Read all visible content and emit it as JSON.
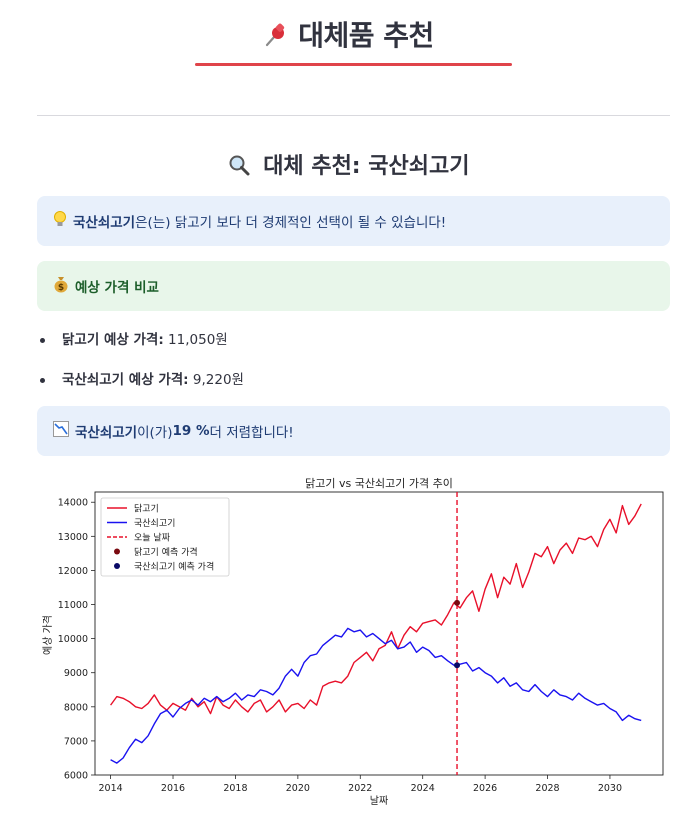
{
  "header": {
    "title_icon": "pushpin-icon",
    "title": "대체품 추천"
  },
  "section": {
    "icon": "magnifier-icon",
    "title": "대체 추천: 국산쇠고기"
  },
  "recommendation": {
    "icon": "lightbulb-icon",
    "item": "국산쇠고기",
    "text": " 은(는) 닭고기 보다 더 경제적인 선택이 될 수 있습니다!"
  },
  "comparison": {
    "icon": "money-bag-icon",
    "title": "예상 가격 비교"
  },
  "prices": [
    {
      "label": "닭고기 예상 가격:",
      "value": " 11,050원"
    },
    {
      "label": "국산쇠고기 예상 가격:",
      "value": " 9,220원"
    }
  ],
  "savings": {
    "icon": "chart-decreasing-icon",
    "item": "국산쇠고기",
    "text1": " 이(가) ",
    "percent": "19 %",
    "text2": " 더 저렴합니다!"
  },
  "colors": {
    "chicken": "#e8102a",
    "beef": "#1a12f0",
    "today": "#e8102a",
    "chicken_pred": "#7a0a10",
    "beef_pred": "#0a0a66"
  },
  "chart_data": {
    "type": "line",
    "title": "닭고기 vs 국산쇠고기 가격 추이",
    "xlabel": "날짜",
    "ylabel": "예상 가격",
    "xlim": [
      2013.5,
      2031.7
    ],
    "ylim": [
      6000,
      14300
    ],
    "x_ticks": [
      2014,
      2016,
      2018,
      2020,
      2022,
      2024,
      2026,
      2028,
      2030
    ],
    "y_ticks": [
      6000,
      7000,
      8000,
      9000,
      10000,
      11000,
      12000,
      13000,
      14000
    ],
    "legend": [
      "닭고기",
      "국산쇠고기",
      "오늘 날짜",
      "닭고기 예측 가격",
      "국산쇠고기 예측 가격"
    ],
    "legend_position": "upper-left",
    "today": 2025.1,
    "series": [
      {
        "name": "닭고기",
        "x": [
          2014.0,
          2014.2,
          2014.4,
          2014.6,
          2014.8,
          2015.0,
          2015.2,
          2015.4,
          2015.6,
          2015.8,
          2016.0,
          2016.2,
          2016.4,
          2016.6,
          2016.8,
          2017.0,
          2017.2,
          2017.4,
          2017.6,
          2017.8,
          2018.0,
          2018.2,
          2018.4,
          2018.6,
          2018.8,
          2019.0,
          2019.2,
          2019.4,
          2019.6,
          2019.8,
          2020.0,
          2020.2,
          2020.4,
          2020.6,
          2020.8,
          2021.0,
          2021.2,
          2021.4,
          2021.6,
          2021.8,
          2022.0,
          2022.2,
          2022.4,
          2022.6,
          2022.8,
          2023.0,
          2023.2,
          2023.4,
          2023.6,
          2023.8,
          2024.0,
          2024.2,
          2024.4,
          2024.6,
          2024.8,
          2025.0,
          2025.2,
          2025.4,
          2025.6,
          2025.8,
          2026.0,
          2026.2,
          2026.4,
          2026.6,
          2026.8,
          2027.0,
          2027.2,
          2027.4,
          2027.6,
          2027.8,
          2028.0,
          2028.2,
          2028.4,
          2028.6,
          2028.8,
          2029.0,
          2029.2,
          2029.4,
          2029.6,
          2029.8,
          2030.0,
          2030.2,
          2030.4,
          2030.6,
          2030.8,
          2031.0
        ],
        "values": [
          8050,
          8300,
          8250,
          8150,
          8000,
          7950,
          8100,
          8350,
          8050,
          7900,
          8100,
          8000,
          7900,
          8250,
          8000,
          8150,
          7800,
          8300,
          8050,
          7950,
          8200,
          8000,
          7850,
          8100,
          8200,
          7850,
          8000,
          8200,
          7850,
          8050,
          8100,
          7950,
          8200,
          8050,
          8600,
          8700,
          8750,
          8700,
          8900,
          9300,
          9450,
          9600,
          9350,
          9700,
          9800,
          10200,
          9700,
          10100,
          10350,
          10200,
          10450,
          10500,
          10550,
          10400,
          10700,
          11050,
          10900,
          11200,
          11400,
          10800,
          11450,
          11900,
          11200,
          11800,
          11600,
          12200,
          11500,
          11950,
          12500,
          12400,
          12700,
          12200,
          12600,
          12800,
          12500,
          12950,
          12900,
          13000,
          12700,
          13200,
          13500,
          13100,
          13900,
          13350,
          13600,
          13950
        ]
      },
      {
        "name": "국산쇠고기",
        "x": [
          2014.0,
          2014.2,
          2014.4,
          2014.6,
          2014.8,
          2015.0,
          2015.2,
          2015.4,
          2015.6,
          2015.8,
          2016.0,
          2016.2,
          2016.4,
          2016.6,
          2016.8,
          2017.0,
          2017.2,
          2017.4,
          2017.6,
          2017.8,
          2018.0,
          2018.2,
          2018.4,
          2018.6,
          2018.8,
          2019.0,
          2019.2,
          2019.4,
          2019.6,
          2019.8,
          2020.0,
          2020.2,
          2020.4,
          2020.6,
          2020.8,
          2021.0,
          2021.2,
          2021.4,
          2021.6,
          2021.8,
          2022.0,
          2022.2,
          2022.4,
          2022.6,
          2022.8,
          2023.0,
          2023.2,
          2023.4,
          2023.6,
          2023.8,
          2024.0,
          2024.2,
          2024.4,
          2024.6,
          2024.8,
          2025.0,
          2025.2,
          2025.4,
          2025.6,
          2025.8,
          2026.0,
          2026.2,
          2026.4,
          2026.6,
          2026.8,
          2027.0,
          2027.2,
          2027.4,
          2027.6,
          2027.8,
          2028.0,
          2028.2,
          2028.4,
          2028.6,
          2028.8,
          2029.0,
          2029.2,
          2029.4,
          2029.6,
          2029.8,
          2030.0,
          2030.2,
          2030.4,
          2030.6,
          2030.8,
          2031.0
        ],
        "values": [
          6450,
          6350,
          6500,
          6800,
          7050,
          6950,
          7150,
          7500,
          7800,
          7900,
          7700,
          7950,
          8100,
          8200,
          8050,
          8250,
          8150,
          8300,
          8150,
          8250,
          8400,
          8200,
          8350,
          8300,
          8500,
          8450,
          8350,
          8550,
          8900,
          9100,
          8900,
          9300,
          9500,
          9550,
          9800,
          9950,
          10100,
          10050,
          10300,
          10200,
          10250,
          10050,
          10150,
          10000,
          9850,
          9950,
          9700,
          9750,
          9900,
          9600,
          9750,
          9650,
          9450,
          9500,
          9350,
          9220,
          9250,
          9300,
          9050,
          9150,
          9000,
          8900,
          8700,
          8850,
          8600,
          8700,
          8500,
          8450,
          8650,
          8450,
          8300,
          8500,
          8350,
          8300,
          8200,
          8400,
          8250,
          8150,
          8050,
          8100,
          7950,
          7850,
          7600,
          7750,
          7650,
          7600
        ]
      }
    ],
    "predictions": [
      {
        "name": "닭고기 예측 가격",
        "x": 2025.1,
        "value": 11050
      },
      {
        "name": "국산쇠고기 예측 가격",
        "x": 2025.1,
        "value": 9220
      }
    ]
  }
}
